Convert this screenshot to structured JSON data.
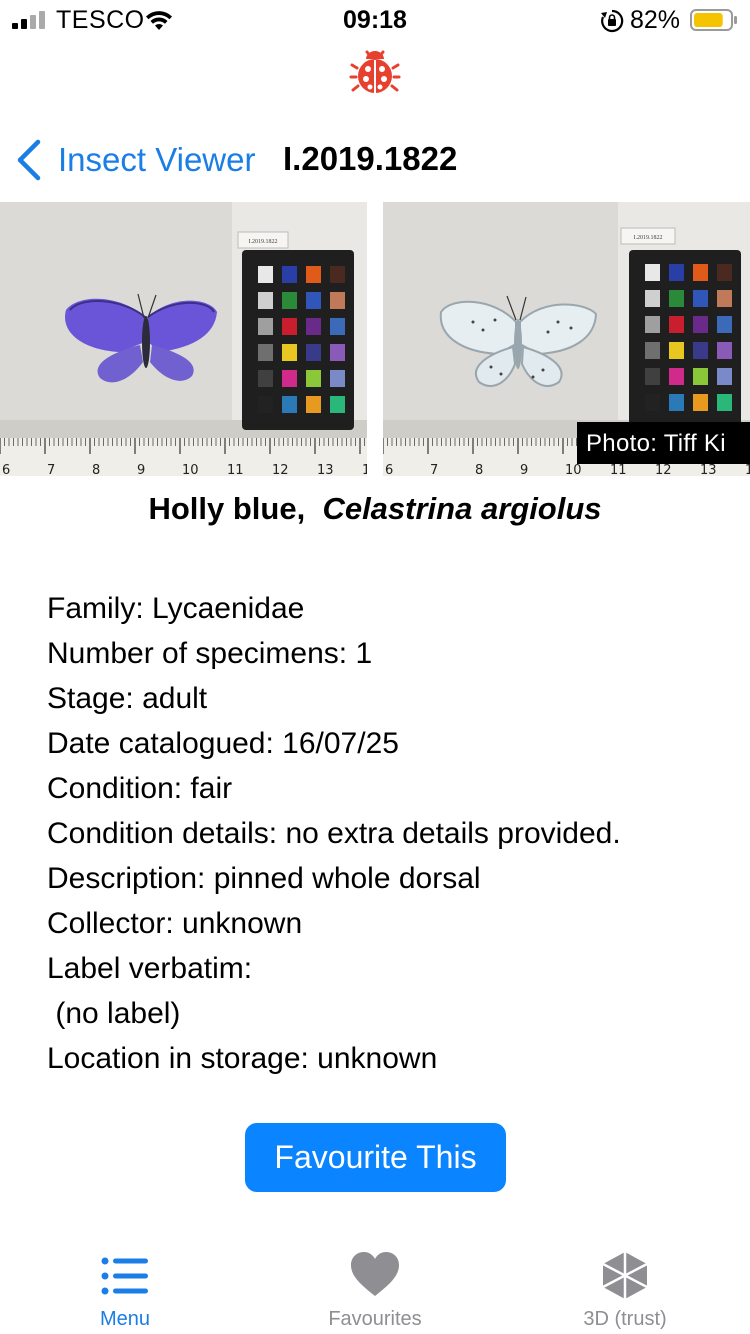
{
  "status_bar": {
    "carrier": "TESCO",
    "time": "09:18",
    "battery_percent": "82%",
    "battery_level": 0.82,
    "icons": [
      "signal-icon",
      "wifi-icon",
      "orientation-lock-icon",
      "battery-icon"
    ]
  },
  "app_logo_icon": "ladybug-icon",
  "nav": {
    "back_label": "Insect Viewer",
    "title": "I.2019.1822"
  },
  "photos": {
    "credit": "Photo: Tiff Ki",
    "label_card": "I.2019.1822"
  },
  "specimen": {
    "common_name": "Holly blue,",
    "scientific_name": "Celastrina argiolus"
  },
  "details": [
    "Family: Lycaenidae",
    "Number of specimens: 1",
    "Stage: adult",
    "Date catalogued: 16/07/25",
    "Condition: fair",
    "Condition details: no extra details provided.",
    "Description: pinned whole dorsal",
    "Collector: unknown",
    "Label verbatim:",
    " (no label)",
    "Location in storage: unknown"
  ],
  "favourite_button": "Favourite This",
  "tabs": [
    {
      "label": "Menu",
      "icon": "list-icon",
      "active": true
    },
    {
      "label": "Favourites",
      "icon": "heart-icon",
      "active": false
    },
    {
      "label": "3D (trust)",
      "icon": "cube-icon",
      "active": false
    }
  ],
  "colors": {
    "accent": "#0a84ff",
    "link": "#1a7ee6",
    "logo": "#e8402e",
    "battery_fill": "#f5c400",
    "inactive_tab": "#8e8e93"
  }
}
